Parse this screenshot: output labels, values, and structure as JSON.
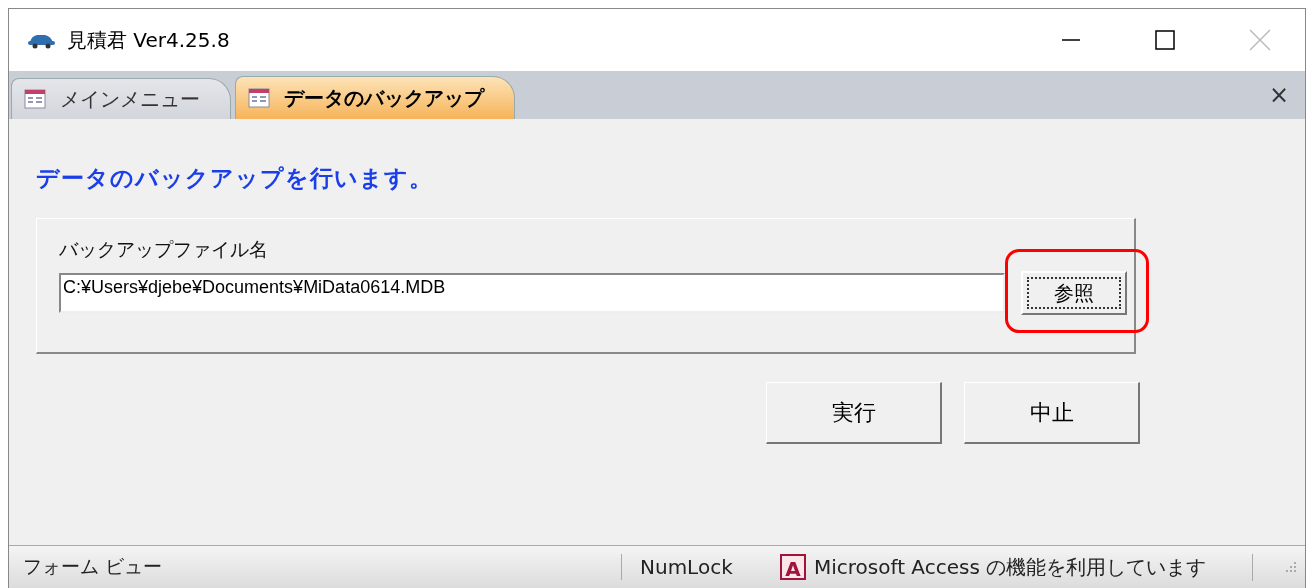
{
  "window": {
    "title": "見積君 Ver4.25.8"
  },
  "tabs": [
    {
      "label": "メインメニュー",
      "selected": false
    },
    {
      "label": "データのバックアップ",
      "selected": true
    }
  ],
  "tab_close": "×",
  "form": {
    "heading": "データのバックアップを行います。",
    "group": {
      "label": "バックアップファイル名",
      "value": "C:¥Users¥djebe¥Documents¥MiData0614.MDB",
      "browse_button": "参照",
      "highlighted": true
    },
    "buttons": [
      "実行",
      "中止"
    ]
  },
  "status_bar": {
    "view": "フォーム ビュー",
    "numlock": "NumLock",
    "app_badge": "A",
    "message": "Microsoft Access の機能を利用しています"
  }
}
